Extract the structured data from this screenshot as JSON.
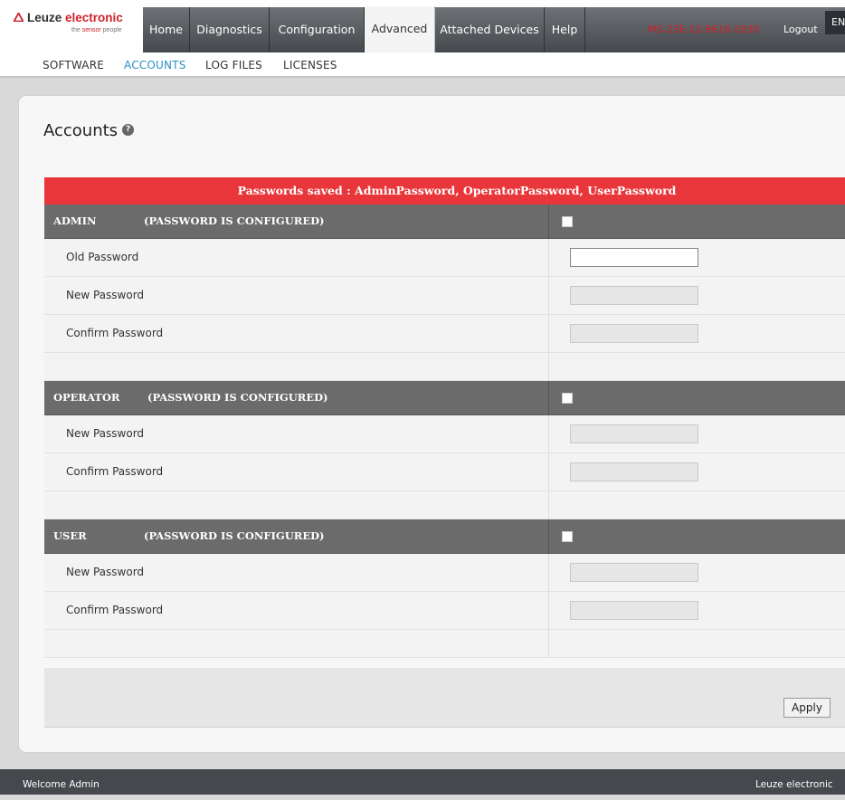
{
  "header": {
    "logo_brand_dark": "Leuze",
    "logo_brand_red": "electronic",
    "logo_tag_1": "the",
    "logo_tag_red": "sensor",
    "logo_tag_2": "people",
    "nav_tabs": [
      {
        "label": "Home"
      },
      {
        "label": "Diagnostics"
      },
      {
        "label": "Configuration"
      },
      {
        "label": "Advanced",
        "active": true
      },
      {
        "label": "Attached Devices"
      },
      {
        "label": "Help"
      }
    ],
    "device_id": "MS-23E-12-8616-2030",
    "logout_label": "Logout",
    "lang_label": "EN"
  },
  "subnav": {
    "tabs": [
      {
        "label": "SOFTWARE"
      },
      {
        "label": "ACCOUNTS",
        "active": true
      },
      {
        "label": "LOG FILES"
      },
      {
        "label": "LICENSES"
      }
    ]
  },
  "page": {
    "title": "Accounts",
    "help_icon": "help-icon",
    "banner": "Passwords saved : AdminPassword, OperatorPassword, UserPassword",
    "sections": [
      {
        "name": "ADMIN",
        "status": "(PASSWORD IS CONFIGURED)",
        "fields": [
          {
            "label": "Old Password",
            "value": "",
            "enabled": true
          },
          {
            "label": "New Password",
            "value": "",
            "enabled": false
          },
          {
            "label": "Confirm Password",
            "value": "",
            "enabled": false
          }
        ]
      },
      {
        "name": "OPERATOR",
        "status": "(PASSWORD IS CONFIGURED)",
        "fields": [
          {
            "label": "New Password",
            "value": "",
            "enabled": false
          },
          {
            "label": "Confirm Password",
            "value": "",
            "enabled": false
          }
        ]
      },
      {
        "name": "USER",
        "status": "(PASSWORD IS CONFIGURED)",
        "fields": [
          {
            "label": "New Password",
            "value": "",
            "enabled": false
          },
          {
            "label": "Confirm Password",
            "value": "",
            "enabled": false
          }
        ]
      }
    ],
    "apply_label": "Apply"
  },
  "statusbar": {
    "welcome": "Welcome Admin",
    "company": "Leuze electronic"
  },
  "colors": {
    "nav_bg": "#55585c",
    "banner_red": "#e8363a",
    "section_header": "#6b6b6b",
    "active_subtab": "#2a8fc6",
    "brand_red": "#d0202a"
  }
}
